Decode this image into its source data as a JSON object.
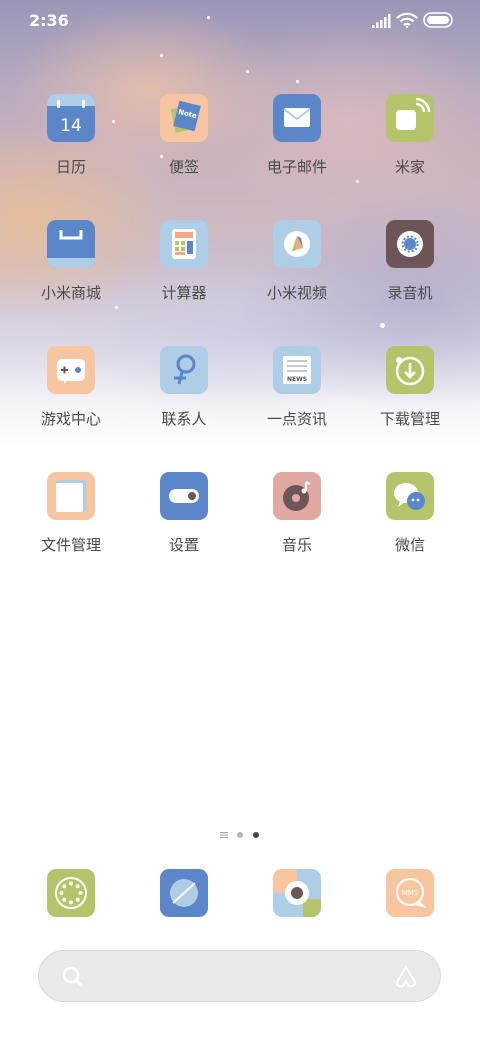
{
  "status_bar": {
    "time": "2:36"
  },
  "apps": [
    {
      "id": "calendar",
      "label": "日历",
      "icon": "calendar-icon",
      "day": "14"
    },
    {
      "id": "notes",
      "label": "便签",
      "icon": "notes-icon",
      "note_text": "Note"
    },
    {
      "id": "email",
      "label": "电子邮件",
      "icon": "email-icon"
    },
    {
      "id": "mihome",
      "label": "米家",
      "icon": "mihome-icon"
    },
    {
      "id": "mistore",
      "label": "小米商城",
      "icon": "store-bag-icon"
    },
    {
      "id": "calculator",
      "label": "计算器",
      "icon": "calculator-icon"
    },
    {
      "id": "video",
      "label": "小米视频",
      "icon": "video-icon"
    },
    {
      "id": "recorder",
      "label": "录音机",
      "icon": "recorder-icon"
    },
    {
      "id": "gamecenter",
      "label": "游戏中心",
      "icon": "gamepad-icon"
    },
    {
      "id": "contacts",
      "label": "联系人",
      "icon": "contacts-icon"
    },
    {
      "id": "news",
      "label": "一点资讯",
      "icon": "news-icon",
      "news_text": "NEWS"
    },
    {
      "id": "downloads",
      "label": "下载管理",
      "icon": "download-icon"
    },
    {
      "id": "files",
      "label": "文件管理",
      "icon": "folder-icon"
    },
    {
      "id": "settings",
      "label": "设置",
      "icon": "toggle-settings-icon"
    },
    {
      "id": "music",
      "label": "音乐",
      "icon": "music-icon"
    },
    {
      "id": "wechat",
      "label": "微信",
      "icon": "wechat-icon"
    }
  ],
  "page_indicator": {
    "pages": 2,
    "current": 2
  },
  "dock": [
    {
      "id": "phone",
      "icon": "dialpad-icon"
    },
    {
      "id": "browser",
      "icon": "browser-icon"
    },
    {
      "id": "camera",
      "icon": "camera-icon"
    },
    {
      "id": "messages",
      "icon": "messages-icon",
      "text": "MMS"
    }
  ],
  "colors": {
    "blue": "#5b86c9",
    "peach": "#f7c6a0",
    "green": "#b4c46a",
    "lightblue": "#aecde7",
    "brown": "#6e5658",
    "rose": "#dfa8a0",
    "label": "#4a4a4a"
  }
}
